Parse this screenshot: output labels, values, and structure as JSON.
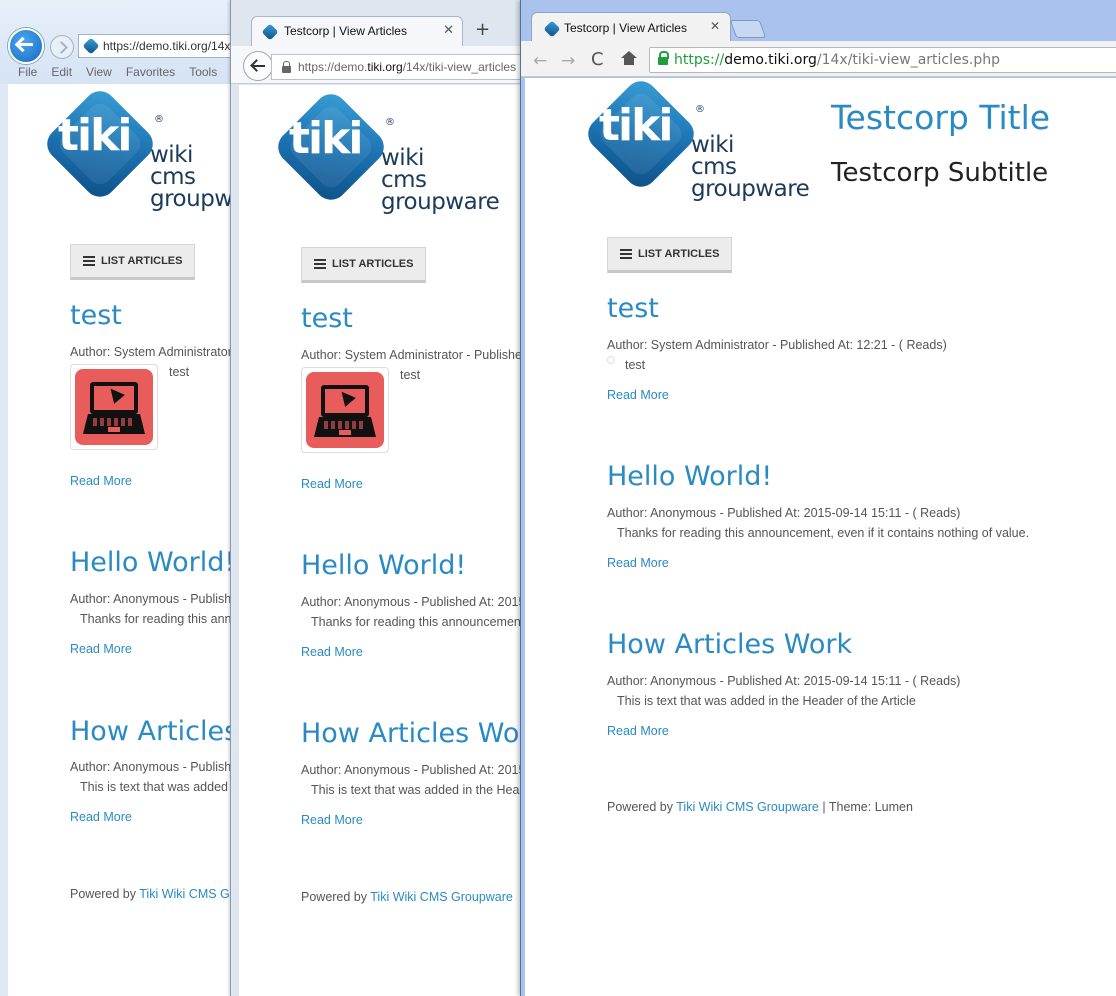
{
  "site": {
    "logo": {
      "tiki": "tiki",
      "reg": "®",
      "line1": "wiki",
      "line2": "cms",
      "line3": "groupware"
    },
    "title": "Testcorp Title",
    "subtitle": "Testcorp Subtitle",
    "list_articles_label": "LIST ARTICLES",
    "articles": [
      {
        "title": "test",
        "author_line": "Author: System Administrator - Published At: 12:21 - ( Reads)",
        "body": "test",
        "image_icon": "laptop-cursor-icon",
        "read_more": "Read More"
      },
      {
        "title": "Hello World!",
        "author_line": "Author: Anonymous - Published At: 2015-09-14 15:11 - ( Reads)",
        "body": "Thanks for reading this announcement, even if it contains nothing of value.",
        "read_more": "Read More"
      },
      {
        "title": "How Articles Work",
        "author_line": "Author: Anonymous - Published At: 2015-09-14 15:11 - ( Reads)",
        "body": "This is text that was added in the Header of the Article",
        "read_more": "Read More"
      }
    ],
    "footer": {
      "powered_by": "Powered by",
      "link": "Tiki Wiki CMS Groupware",
      "theme": "| Theme: Lumen"
    }
  },
  "ie": {
    "address": "https://demo.tiki.org/14x/tiki-view_articles.php",
    "address_visible": "https://demo.tiki.org/14",
    "menu": [
      "File",
      "Edit",
      "View",
      "Favorites",
      "Tools"
    ]
  },
  "firefox": {
    "tab_label": "Testcorp | View Articles",
    "close": "✕",
    "new_tab": "+",
    "url_prefix": "https://demo.",
    "url_host": "tiki.org",
    "url_path": "/14x/tiki-view_articles"
  },
  "chrome": {
    "tab_label": "Testcorp | View Articles",
    "close": "✕",
    "back": "←",
    "forward": "→",
    "reload": "C",
    "url_scheme": "https://",
    "url_host": "demo.tiki.org",
    "url_path": "/14x/tiki-view_articles.php"
  },
  "colors": {
    "link": "#2a8ac4",
    "text": "#555555",
    "logo_blue": "#1a6fae",
    "logo_dark": "#1c3b5b",
    "icon_red": "#e85c5c"
  }
}
